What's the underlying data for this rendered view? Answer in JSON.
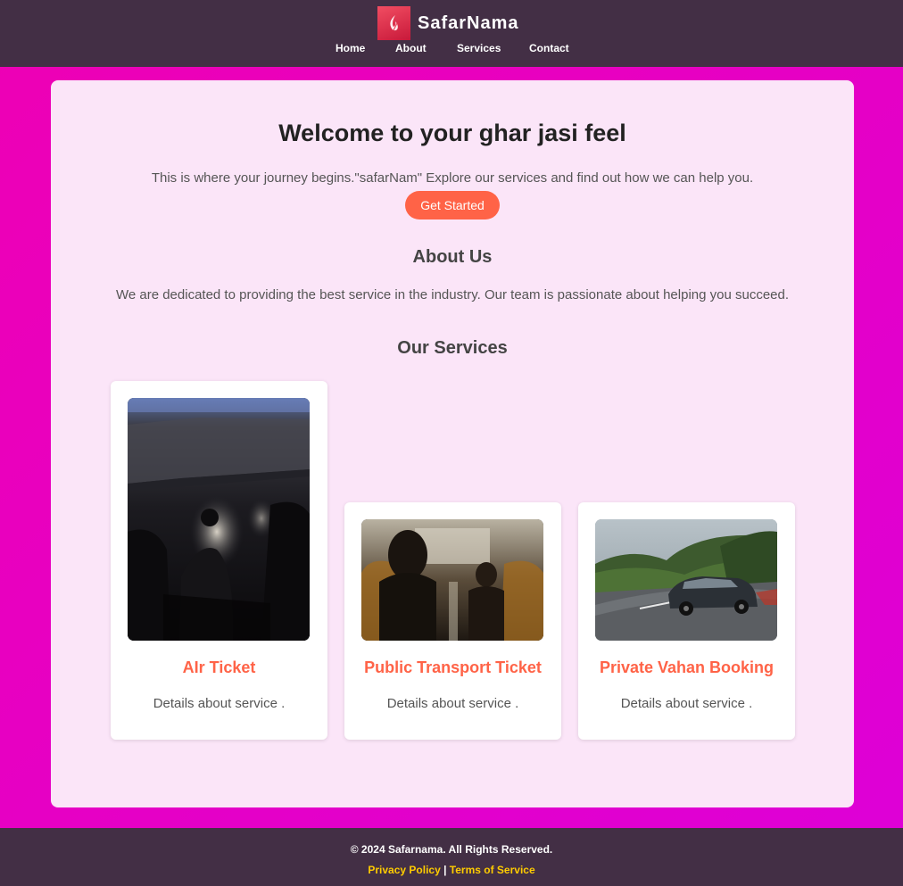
{
  "header": {
    "brand": "SafarNama",
    "nav": [
      {
        "label": "Home"
      },
      {
        "label": "About"
      },
      {
        "label": "Services"
      },
      {
        "label": "Contact"
      }
    ]
  },
  "hero": {
    "title": "Welcome to your ghar jasi feel",
    "text": "This is where your journey begins.\"safarNam\" Explore our services and find out how we can help you.",
    "button": "Get Started"
  },
  "about": {
    "title": "About Us",
    "text": "We are dedicated to providing the best service in the industry. Our team is passionate about helping you succeed."
  },
  "services": {
    "title": "Our Services",
    "items": [
      {
        "title": "AIr Ticket",
        "text": "Details about service ."
      },
      {
        "title": "Public Transport Ticket",
        "text": "Details about service ."
      },
      {
        "title": "Private Vahan Booking",
        "text": "Details about service ."
      }
    ]
  },
  "footer": {
    "copyright": "© 2024 Safarnama. All Rights Reserved.",
    "privacy": "Privacy Policy",
    "separator": "|",
    "terms": "Terms of Service"
  },
  "colors": {
    "header_bg": "#432f45",
    "page_bg": "#e800c0",
    "accent": "#ff6347",
    "footer_link": "#ffcc00"
  },
  "icons": {
    "logo": "flame-leaf-icon"
  }
}
